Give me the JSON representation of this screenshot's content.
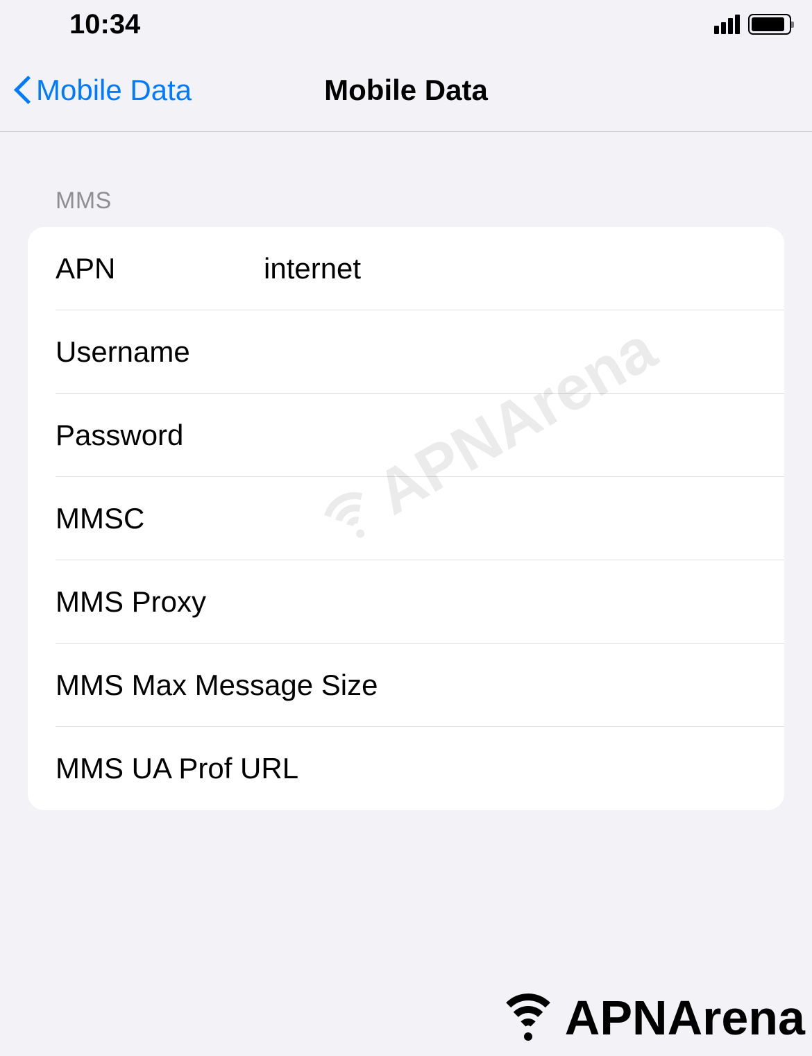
{
  "status": {
    "time": "10:34"
  },
  "nav": {
    "back_label": "Mobile Data",
    "title": "Mobile Data"
  },
  "section": {
    "header": "MMS"
  },
  "fields": {
    "apn": {
      "label": "APN",
      "value": "internet"
    },
    "username": {
      "label": "Username",
      "value": ""
    },
    "password": {
      "label": "Password",
      "value": ""
    },
    "mmsc": {
      "label": "MMSC",
      "value": ""
    },
    "mms_proxy": {
      "label": "MMS Proxy",
      "value": ""
    },
    "mms_max": {
      "label": "MMS Max Message Size",
      "value": ""
    },
    "mms_ua": {
      "label": "MMS UA Prof URL",
      "value": ""
    }
  },
  "watermark": {
    "text": "APNArena"
  }
}
